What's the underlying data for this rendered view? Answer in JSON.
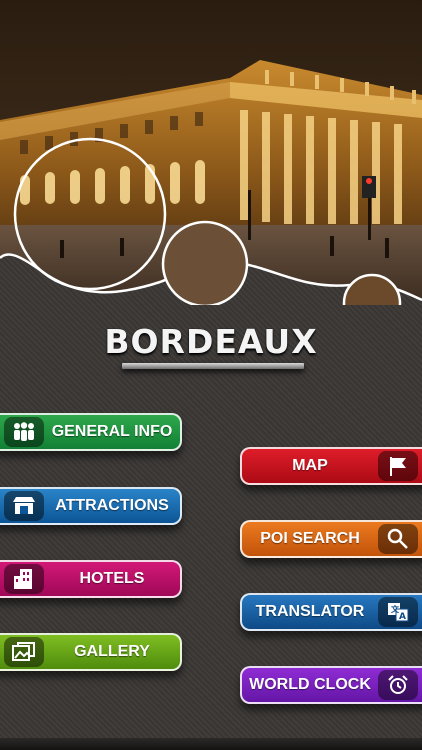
{
  "app": {
    "title": "BORDEAUX"
  },
  "hero": {
    "image_description_icon": "bordeaux-grand-theatre-night-photo"
  },
  "menu": {
    "general_info": {
      "label": "GENERAL INFO",
      "icon": "people-icon",
      "color": "#1f9440"
    },
    "attractions": {
      "label": "ATTRACTIONS",
      "icon": "shop-awning-icon",
      "color": "#1b6fb3"
    },
    "hotels": {
      "label": "HOTELS",
      "icon": "building-icon",
      "color": "#c0106a"
    },
    "gallery": {
      "label": "GALLERY",
      "icon": "photos-icon",
      "color": "#6aa819"
    },
    "map": {
      "label": "MAP",
      "icon": "flag-icon",
      "color": "#c81420"
    },
    "poi_search": {
      "label": "POI SEARCH",
      "icon": "magnifier-icon",
      "color": "#d86614"
    },
    "translator": {
      "label": "TRANSLATOR",
      "icon": "translate-icon",
      "color": "#1a62a6"
    },
    "world_clock": {
      "label": "WORLD CLOCK",
      "icon": "alarm-clock-icon",
      "color": "#7a20bd"
    }
  }
}
